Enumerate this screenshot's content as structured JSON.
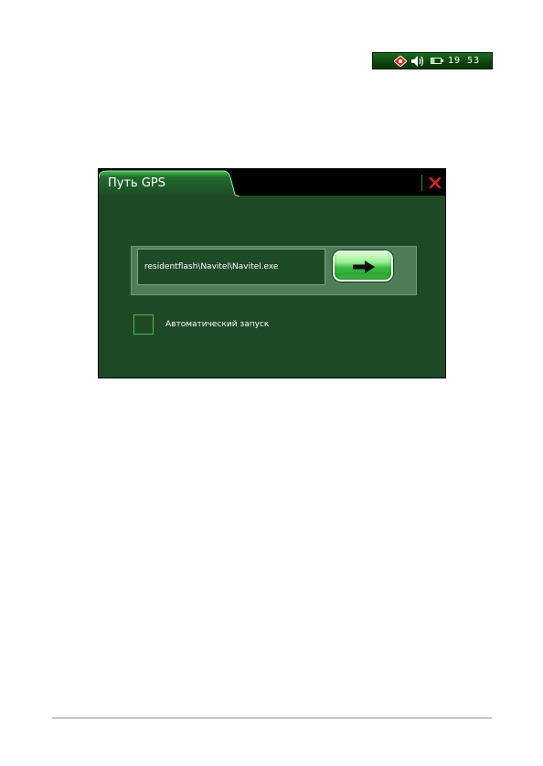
{
  "status_bar": {
    "icons": [
      "gps-status-icon",
      "volume-icon",
      "battery-icon"
    ],
    "time": "19 53",
    "background_color": "#0b3f0b"
  },
  "dialog": {
    "title": "Путь GPS",
    "path_value": "residentflash\\Navitel\\Navitel.exe",
    "go_button_icon": "arrow-right-icon",
    "close_icon": "close-icon",
    "checkbox_label": "Автоматический запуск",
    "checkbox_checked": false,
    "colors": {
      "background": "#1d4a25",
      "title_strip": "#000000",
      "accent": "#3fbf45",
      "close": "#e0201a"
    }
  }
}
